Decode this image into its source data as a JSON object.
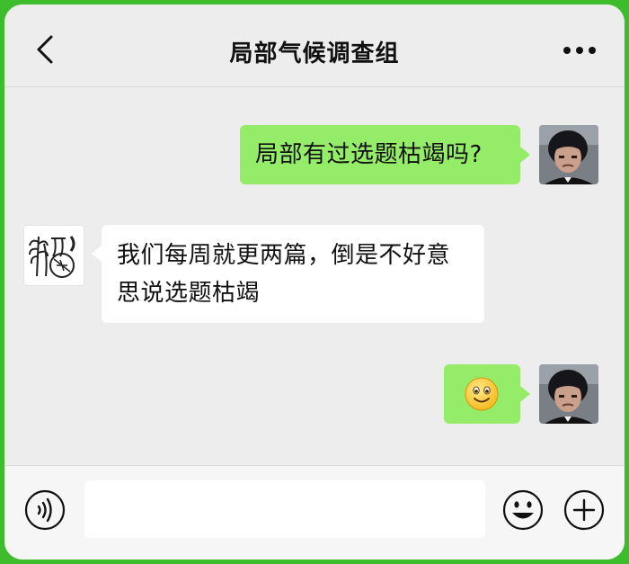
{
  "header": {
    "title": "局部气候调查组",
    "back_icon": "chevron-left-icon",
    "more_icon": "more-horizontal-icon"
  },
  "messages": [
    {
      "sender": "me",
      "text": "局部有过选题枯竭吗?"
    },
    {
      "sender": "them",
      "lines": [
        "我们每周就更两篇，倒是不好意",
        "思说选题枯竭"
      ]
    },
    {
      "sender": "me",
      "emoji": "🙂",
      "emoji_name": "smile-emoji"
    }
  ],
  "footer": {
    "voice_icon": "voice-icon",
    "input_value": "",
    "emoji_icon": "emoji-icon",
    "add_icon": "plus-circle-icon"
  },
  "colors": {
    "frame_border": "#3dbd2b",
    "my_bubble": "#95ec69",
    "their_bubble": "#ffffff",
    "background": "#ededed"
  }
}
